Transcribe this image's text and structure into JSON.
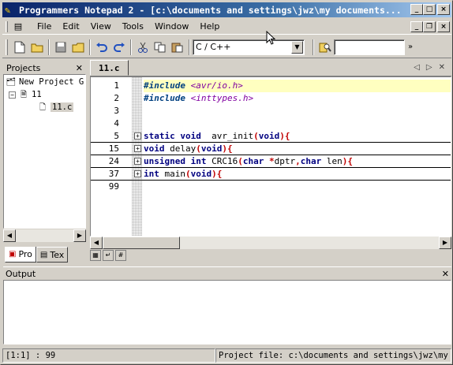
{
  "window": {
    "title": "Programmers Notepad 2 - [c:\\documents and settings\\jwz\\my documents..."
  },
  "menu": [
    "File",
    "Edit",
    "View",
    "Tools",
    "Window",
    "Help"
  ],
  "toolbar": {
    "language_select": "C / C++",
    "search_placeholder": ""
  },
  "projects_panel": {
    "title": "Projects",
    "tree": {
      "root": "New Project G",
      "folder": "11",
      "file": "11.c"
    },
    "tabs": [
      "Pro",
      "Tex"
    ]
  },
  "editor": {
    "tab_label": "11.c",
    "lines": [
      {
        "num": "1",
        "highlight": true,
        "fold": false,
        "ruled": false,
        "tokens": [
          [
            "pp",
            "#include "
          ],
          [
            "inc",
            "<avr/io.h>"
          ]
        ]
      },
      {
        "num": "2",
        "highlight": false,
        "fold": false,
        "ruled": false,
        "tokens": [
          [
            "pp",
            "#include "
          ],
          [
            "inc",
            "<inttypes.h>"
          ]
        ]
      },
      {
        "num": "3",
        "highlight": false,
        "fold": false,
        "ruled": false,
        "tokens": []
      },
      {
        "num": "4",
        "highlight": false,
        "fold": false,
        "ruled": false,
        "tokens": []
      },
      {
        "num": "5",
        "highlight": false,
        "fold": true,
        "ruled": true,
        "tokens": [
          [
            "kw",
            "static void"
          ],
          [
            "",
            "  avr_init"
          ],
          [
            "op",
            "("
          ],
          [
            "kw",
            "void"
          ],
          [
            "op",
            "){"
          ]
        ]
      },
      {
        "num": "15",
        "highlight": false,
        "fold": true,
        "ruled": true,
        "tokens": [
          [
            "kw",
            "void"
          ],
          [
            "",
            " delay"
          ],
          [
            "op",
            "("
          ],
          [
            "kw",
            "void"
          ],
          [
            "op",
            "){"
          ]
        ]
      },
      {
        "num": "24",
        "highlight": false,
        "fold": true,
        "ruled": true,
        "tokens": [
          [
            "kw",
            "unsigned int"
          ],
          [
            "",
            " CRC16"
          ],
          [
            "op",
            "("
          ],
          [
            "kw",
            "char"
          ],
          [
            "op",
            " *"
          ],
          [
            "",
            "dptr"
          ],
          [
            "op",
            ","
          ],
          [
            "kw",
            "char"
          ],
          [
            "",
            " len"
          ],
          [
            "op",
            "){"
          ]
        ]
      },
      {
        "num": "37",
        "highlight": false,
        "fold": true,
        "ruled": true,
        "tokens": [
          [
            "kw",
            "int"
          ],
          [
            "",
            " main"
          ],
          [
            "op",
            "("
          ],
          [
            "kw",
            "void"
          ],
          [
            "op",
            "){"
          ]
        ]
      },
      {
        "num": "99",
        "highlight": false,
        "fold": false,
        "ruled": false,
        "tokens": []
      }
    ]
  },
  "output_panel": {
    "title": "Output"
  },
  "statusbar": {
    "position": "[1:1] : 99",
    "project_file": "Project file: c:\\documents and settings\\jwz\\my"
  }
}
